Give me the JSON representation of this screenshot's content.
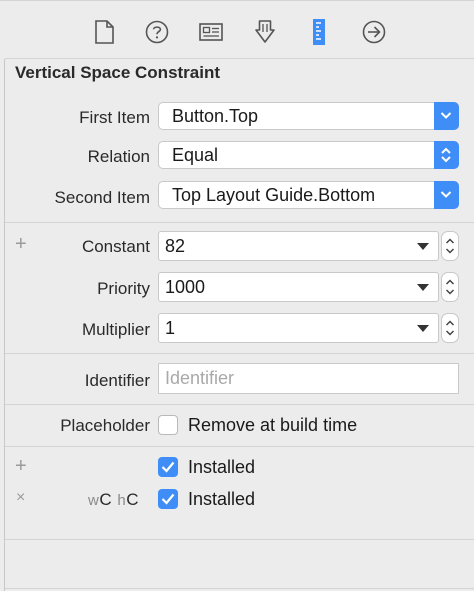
{
  "header": {
    "title": "Vertical Space Constraint"
  },
  "toolbar": {
    "icons": [
      "file-inspector-icon",
      "quick-help-icon",
      "identity-inspector-icon",
      "attributes-inspector-icon",
      "size-inspector-icon",
      "connections-inspector-icon"
    ],
    "selected": "size-inspector-icon",
    "accent_color": "#3f8ef7"
  },
  "fields": {
    "first_item": {
      "label": "First Item",
      "value": "Button.Top"
    },
    "relation": {
      "label": "Relation",
      "value": "Equal"
    },
    "second_item": {
      "label": "Second Item",
      "value": "Top Layout Guide.Bottom"
    },
    "constant": {
      "label": "Constant",
      "value": "82"
    },
    "priority": {
      "label": "Priority",
      "value": "1000"
    },
    "multiplier": {
      "label": "Multiplier",
      "value": "1"
    },
    "identifier": {
      "label": "Identifier",
      "value": "",
      "placeholder": "Identifier"
    },
    "placeholder": {
      "label": "Placeholder",
      "checkbox_label": "Remove at build time",
      "checked": false
    }
  },
  "installed": [
    {
      "size_class_w": "w",
      "size_class_w_value": "C",
      "size_class_h": "h",
      "size_class_h_value": "C",
      "label": "Installed",
      "checked": true
    },
    {
      "label": "Installed",
      "checked": true
    }
  ]
}
